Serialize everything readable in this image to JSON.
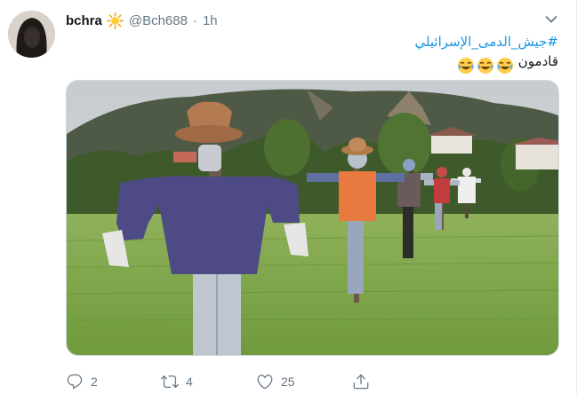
{
  "tweet": {
    "display_name": "bchra",
    "name_emoji": "sun-icon",
    "handle": "@Bch688",
    "separator": "·",
    "time": "1h",
    "hashtag": "#جيش_الدمى_الإسرائيلي",
    "text_line2": "قادمون",
    "emoji_line2": "face-with-tears-of-joy x3",
    "media_alt": "scarecrows in a rice field"
  },
  "actions": {
    "reply_count": "2",
    "retweet_count": "4",
    "like_count": "25"
  },
  "colors": {
    "link": "#1b95e0",
    "secondary_text": "#657786",
    "primary_text": "#14171a",
    "border": "#e6ecf0"
  }
}
